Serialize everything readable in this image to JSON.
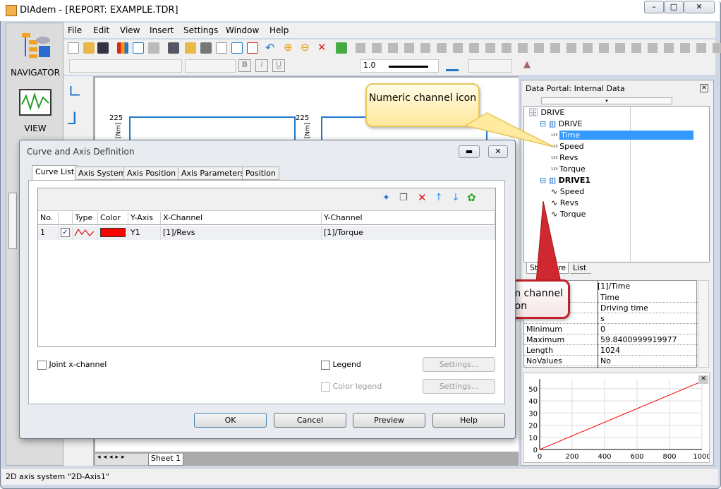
{
  "window": {
    "title": "DIAdem - [REPORT:   EXAMPLE.TDR]"
  },
  "nav": {
    "navigator": "NAVIGATOR",
    "view": "VIEW"
  },
  "menu": [
    "File",
    "Edit",
    "View",
    "Insert",
    "Settings",
    "Window",
    "Help"
  ],
  "toolbar": {
    "line_width": "1.0"
  },
  "sheet_tab": "Sheet 1",
  "axis_labels": {
    "y_top": "225",
    "unit": "[Nm]"
  },
  "status": "2D axis system \"2D-Axis1\"",
  "portal": {
    "title": "Data Portal: Internal Data",
    "tree": [
      {
        "label": "DRIVE",
        "level": 0,
        "type": "root"
      },
      {
        "label": "DRIVE",
        "level": 1,
        "type": "group"
      },
      {
        "label": "Time",
        "level": 2,
        "type": "numeric",
        "selected": true
      },
      {
        "label": "Speed",
        "level": 2,
        "type": "numeric"
      },
      {
        "label": "Revs",
        "level": 2,
        "type": "numeric"
      },
      {
        "label": "Torque",
        "level": 2,
        "type": "numeric"
      },
      {
        "label": "DRIVE1",
        "level": 1,
        "type": "group"
      },
      {
        "label": "Speed",
        "level": 2,
        "type": "waveform"
      },
      {
        "label": "Revs",
        "level": 2,
        "type": "waveform"
      },
      {
        "label": "Torque",
        "level": 2,
        "type": "waveform"
      }
    ],
    "tabs": [
      "Structure",
      "List"
    ],
    "props_header": "[1]/Time",
    "props": [
      {
        "k": "",
        "v": "Time"
      },
      {
        "k": "",
        "v": "Driving time"
      },
      {
        "k": "",
        "v": "s"
      },
      {
        "k": "Minimum",
        "v": "0"
      },
      {
        "k": "Maximum",
        "v": "59.8400999919977"
      },
      {
        "k": "Length",
        "v": "1024"
      },
      {
        "k": "NoValues",
        "v": "No"
      }
    ]
  },
  "chart_data": {
    "type": "line",
    "x": [
      0,
      1000
    ],
    "series": [
      {
        "values": [
          0,
          56
        ],
        "color": "#ff0000"
      }
    ],
    "xlim": [
      0,
      1000
    ],
    "ylim": [
      0,
      58
    ],
    "xticks": [
      "0",
      "200",
      "400",
      "600",
      "800",
      "1000"
    ],
    "yticks": [
      "0",
      "10",
      "20",
      "30",
      "40",
      "50"
    ],
    "grid": true
  },
  "callouts": {
    "numeric": "Numeric channel icon",
    "waveform": "Waveform channel icon"
  },
  "dialog": {
    "title": "Curve and Axis Definition",
    "tabs": [
      "Curve List",
      "Axis System",
      "Axis Position",
      "Axis Parameters",
      "Position"
    ],
    "columns": [
      "No.",
      "",
      "Type",
      "Color",
      "Y-Axis",
      "X-Channel",
      "Y-Channel"
    ],
    "rows": [
      {
        "no": "1",
        "checked": true,
        "color": "#ff0000",
        "yaxis": "Y1",
        "x": "[1]/Revs",
        "y": "[1]/Torque"
      }
    ],
    "joint_x": "Joint x-channel",
    "legend": "Legend",
    "color_legend": "Color legend",
    "settings": "Settings...",
    "buttons": {
      "ok": "OK",
      "cancel": "Cancel",
      "preview": "Preview",
      "help": "Help"
    }
  }
}
